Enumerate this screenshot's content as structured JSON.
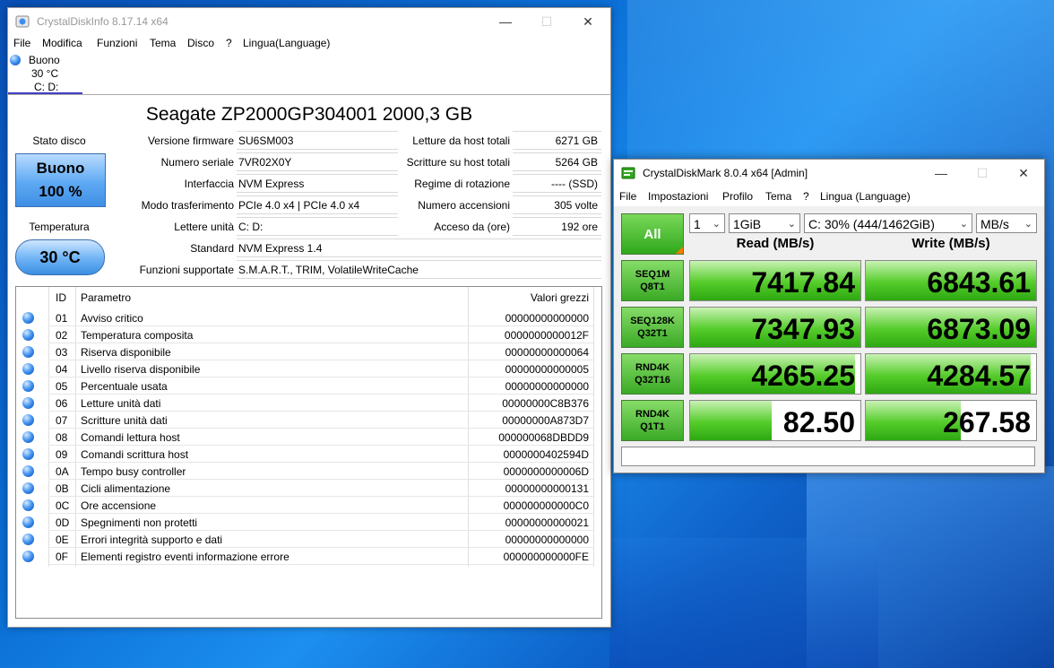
{
  "cdi": {
    "title": "CrystalDiskInfo 8.17.14 x64",
    "menu": [
      "File",
      "Modifica",
      "Funzioni",
      "Tema",
      "Disco",
      "?",
      "Lingua(Language)"
    ],
    "disk_tab": {
      "status": "Buono",
      "temp": "30 °C",
      "letters": "C: D:"
    },
    "model": "Seagate ZP2000GP304001 2000,3 GB",
    "health_label": "Stato disco",
    "health_status": "Buono",
    "health_percent": "100 %",
    "temp_label": "Temperatura",
    "temp_value": "30 °C",
    "left_info": [
      {
        "label": "Versione firmware",
        "value": "SU6SM003"
      },
      {
        "label": "Numero seriale",
        "value": "7VR02X0Y"
      },
      {
        "label": "Interfaccia",
        "value": "NVM Express"
      },
      {
        "label": "Modo trasferimento",
        "value": "PCIe 4.0 x4 | PCIe 4.0 x4"
      },
      {
        "label": "Lettere unità",
        "value": "C: D:"
      }
    ],
    "right_info": [
      {
        "label": "Letture da host totali",
        "value": "6271 GB"
      },
      {
        "label": "Scritture su host totali",
        "value": "5264 GB"
      },
      {
        "label": "Regime di rotazione",
        "value": "---- (SSD)"
      },
      {
        "label": "Numero accensioni",
        "value": "305 volte"
      },
      {
        "label": "Acceso da (ore)",
        "value": "192 ore"
      }
    ],
    "standard_label": "Standard",
    "standard_value": "NVM Express 1.4",
    "features_label": "Funzioni supportate",
    "features_value": "S.M.A.R.T., TRIM, VolatileWriteCache",
    "smart_headers": {
      "id": "ID",
      "param": "Parametro",
      "raw": "Valori grezzi"
    },
    "smart_rows": [
      {
        "id": "01",
        "param": "Avviso critico",
        "raw": "00000000000000"
      },
      {
        "id": "02",
        "param": "Temperatura composita",
        "raw": "0000000000012F"
      },
      {
        "id": "03",
        "param": "Riserva disponibile",
        "raw": "00000000000064"
      },
      {
        "id": "04",
        "param": "Livello riserva disponibile",
        "raw": "00000000000005"
      },
      {
        "id": "05",
        "param": "Percentuale usata",
        "raw": "00000000000000"
      },
      {
        "id": "06",
        "param": "Letture unità dati",
        "raw": "00000000C8B376"
      },
      {
        "id": "07",
        "param": "Scritture unità dati",
        "raw": "00000000A873D7"
      },
      {
        "id": "08",
        "param": "Comandi lettura host",
        "raw": "000000068DBDD9"
      },
      {
        "id": "09",
        "param": "Comandi scrittura host",
        "raw": "0000000402594D"
      },
      {
        "id": "0A",
        "param": "Tempo busy controller",
        "raw": "0000000000006D"
      },
      {
        "id": "0B",
        "param": "Cicli alimentazione",
        "raw": "00000000000131"
      },
      {
        "id": "0C",
        "param": "Ore accensione",
        "raw": "000000000000C0"
      },
      {
        "id": "0D",
        "param": "Spegnimenti non protetti",
        "raw": "00000000000021"
      },
      {
        "id": "0E",
        "param": "Errori integrità supporto e dati",
        "raw": "00000000000000"
      },
      {
        "id": "0F",
        "param": "Elementi registro eventi informazione errore",
        "raw": "000000000000FE"
      }
    ]
  },
  "cdm": {
    "title": "CrystalDiskMark 8.0.4 x64 [Admin]",
    "menu": [
      "File",
      "Impostazioni",
      "Profilo",
      "Tema",
      "?",
      "Lingua (Language)"
    ],
    "all_label": "All",
    "count": "1",
    "size": "1GiB",
    "drive": "C: 30% (444/1462GiB)",
    "unit": "MB/s",
    "read_header": "Read (MB/s)",
    "write_header": "Write (MB/s)",
    "tests": [
      {
        "line1": "SEQ1M",
        "line2": "Q8T1",
        "read": "7417.84",
        "write": "6843.61",
        "read_fill": 1.0,
        "write_fill": 1.0
      },
      {
        "line1": "SEQ128K",
        "line2": "Q32T1",
        "read": "7347.93",
        "write": "6873.09",
        "read_fill": 1.0,
        "write_fill": 1.0
      },
      {
        "line1": "RND4K",
        "line2": "Q32T16",
        "read": "4265.25",
        "write": "4284.57",
        "read_fill": 0.97,
        "write_fill": 0.97
      },
      {
        "line1": "RND4K",
        "line2": "Q1T1",
        "read": "82.50",
        "write": "267.58",
        "read_fill": 0.48,
        "write_fill": 0.56
      }
    ],
    "status": ""
  },
  "colors": {
    "accent_blue": "#3d8ef0",
    "bar_green": "#54cc2a",
    "all_green": "#2fa81b"
  }
}
